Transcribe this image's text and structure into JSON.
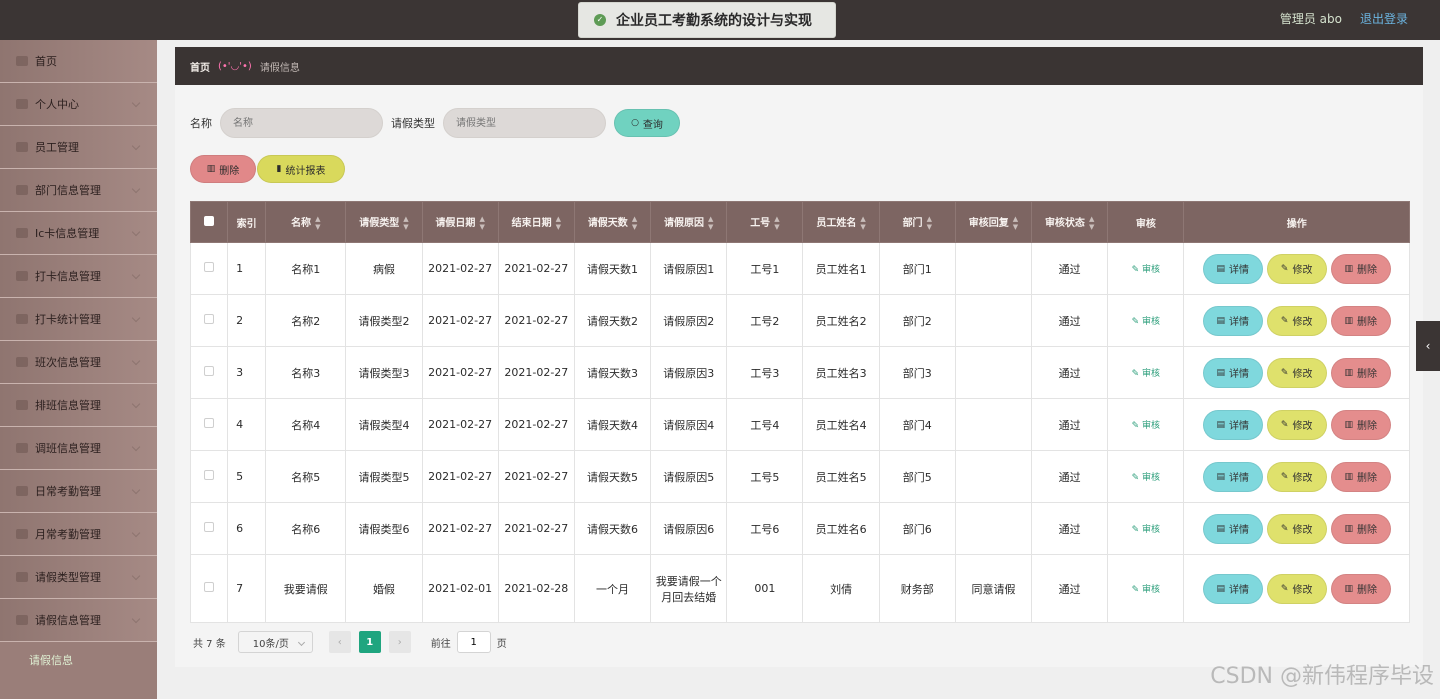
{
  "header": {
    "title": "企业员工考勤系统的设计与实现",
    "admin_label": "管理员 abo",
    "logout_label": "退出登录"
  },
  "sidebar": {
    "items": [
      {
        "label": "首页",
        "icon": "home-icon"
      },
      {
        "label": "个人中心",
        "icon": "user-icon"
      },
      {
        "label": "员工管理",
        "icon": "flag-icon"
      },
      {
        "label": "部门信息管理",
        "icon": "list-icon"
      },
      {
        "label": "Ic卡信息管理",
        "icon": "card-icon"
      },
      {
        "label": "打卡信息管理",
        "icon": "clock-icon"
      },
      {
        "label": "打卡统计管理",
        "icon": "chart-icon"
      },
      {
        "label": "班次信息管理",
        "icon": "calendar-icon"
      },
      {
        "label": "排班信息管理",
        "icon": "schedule-icon"
      },
      {
        "label": "调班信息管理",
        "icon": "grid-icon"
      },
      {
        "label": "日常考勤管理",
        "icon": "send-icon"
      },
      {
        "label": "月常考勤管理",
        "icon": "person-icon"
      },
      {
        "label": "请假类型管理",
        "icon": "bars-icon"
      },
      {
        "label": "请假信息管理",
        "icon": "power-icon"
      }
    ],
    "active_sub": "请假信息"
  },
  "breadcrumb": {
    "home": "首页",
    "separator": "(•'◡'•)",
    "current": "请假信息"
  },
  "search": {
    "name_label": "名称",
    "name_placeholder": "名称",
    "type_label": "请假类型",
    "type_placeholder": "请假类型",
    "query_label": "查询"
  },
  "actions": {
    "delete_label": "删除",
    "stats_label": "统计报表"
  },
  "table": {
    "headers": [
      "索引",
      "名称",
      "请假类型",
      "请假日期",
      "结束日期",
      "请假天数",
      "请假原因",
      "工号",
      "员工姓名",
      "部门",
      "审核回复",
      "审核状态",
      "审核",
      "操作"
    ],
    "rows": [
      [
        "1",
        "名称1",
        "病假",
        "2021-02-27",
        "2021-02-27",
        "请假天数1",
        "请假原因1",
        "工号1",
        "员工姓名1",
        "部门1",
        "",
        "通过"
      ],
      [
        "2",
        "名称2",
        "请假类型2",
        "2021-02-27",
        "2021-02-27",
        "请假天数2",
        "请假原因2",
        "工号2",
        "员工姓名2",
        "部门2",
        "",
        "通过"
      ],
      [
        "3",
        "名称3",
        "请假类型3",
        "2021-02-27",
        "2021-02-27",
        "请假天数3",
        "请假原因3",
        "工号3",
        "员工姓名3",
        "部门3",
        "",
        "通过"
      ],
      [
        "4",
        "名称4",
        "请假类型4",
        "2021-02-27",
        "2021-02-27",
        "请假天数4",
        "请假原因4",
        "工号4",
        "员工姓名4",
        "部门4",
        "",
        "通过"
      ],
      [
        "5",
        "名称5",
        "请假类型5",
        "2021-02-27",
        "2021-02-27",
        "请假天数5",
        "请假原因5",
        "工号5",
        "员工姓名5",
        "部门5",
        "",
        "通过"
      ],
      [
        "6",
        "名称6",
        "请假类型6",
        "2021-02-27",
        "2021-02-27",
        "请假天数6",
        "请假原因6",
        "工号6",
        "员工姓名6",
        "部门6",
        "",
        "通过"
      ],
      [
        "7",
        "我要请假",
        "婚假",
        "2021-02-01",
        "2021-02-28",
        "一个月",
        "我要请假一个月回去结婚",
        "001",
        "刘倩",
        "财务部",
        "同意请假",
        "通过"
      ]
    ],
    "audit_link": "审核",
    "op_detail": "详情",
    "op_edit": "修改",
    "op_delete": "删除"
  },
  "pagination": {
    "total": "共 7 条",
    "page_size": "10条/页",
    "current_page": "1",
    "goto_prefix": "前往",
    "goto_value": "1",
    "goto_suffix": "页"
  },
  "watermark": "CSDN @新伟程序毕设",
  "colors": {
    "accent": "#1fa57f",
    "header_bg": "#3b3534",
    "table_header": "#7d6562"
  }
}
